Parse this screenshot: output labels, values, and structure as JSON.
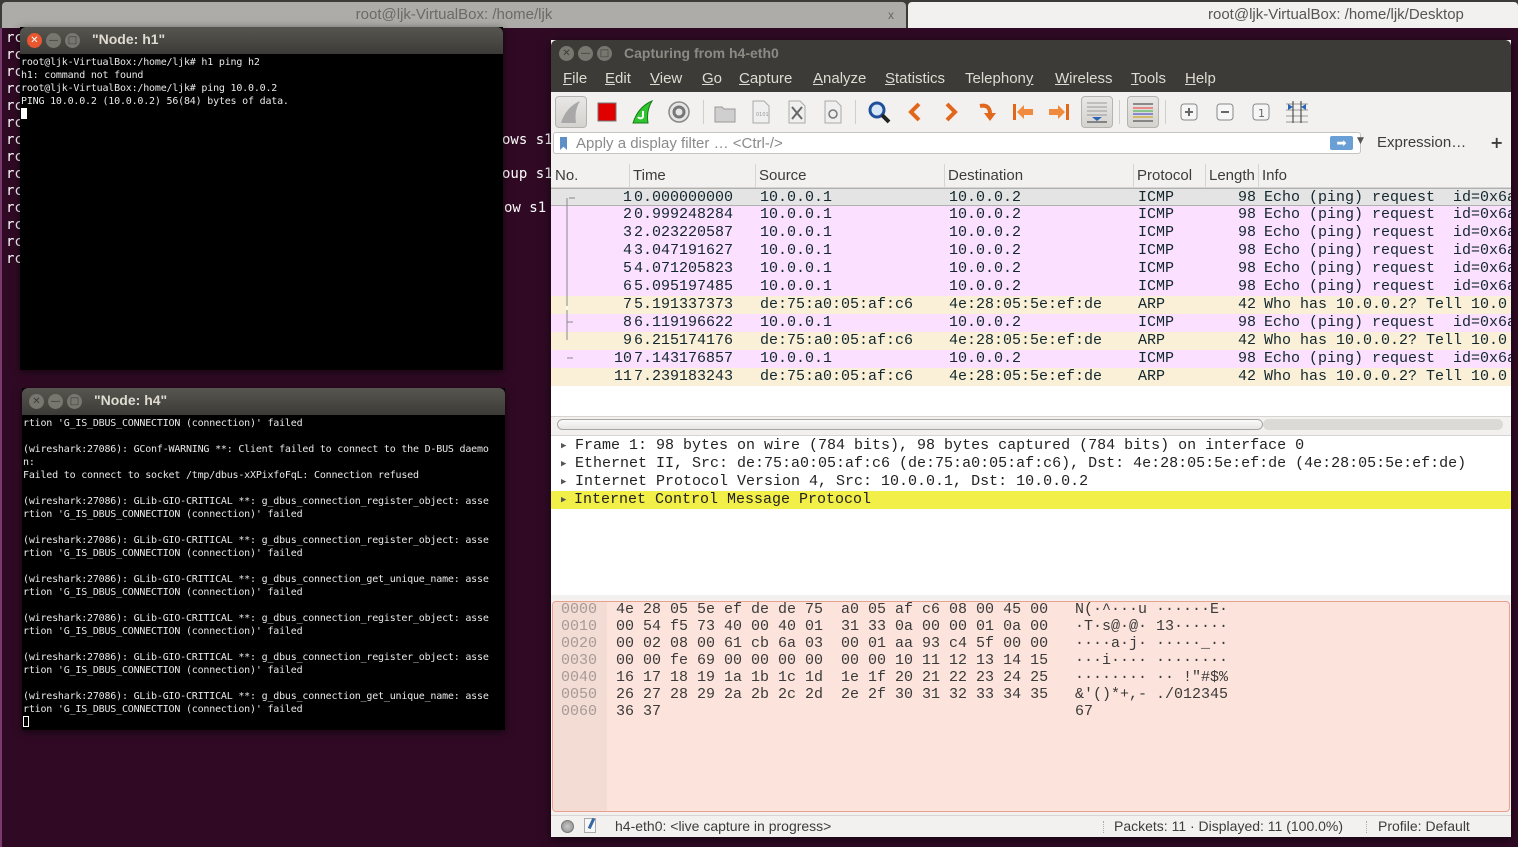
{
  "background_terminal": {
    "tabs": [
      {
        "title": "root@ljk-VirtualBox: /home/ljk",
        "close": "x"
      },
      {
        "title": "root@ljk-VirtualBox: /home/ljk/Desktop"
      }
    ],
    "line_prefix": "rc",
    "visible_fragments": [
      "ows s1",
      "oup s1",
      "ow s1"
    ]
  },
  "node_h1": {
    "title": "\"Node: h1\"",
    "lines": [
      "root@ljk-VirtualBox:/home/ljk# h1 ping h2",
      "h1: command not found",
      "root@ljk-VirtualBox:/home/ljk# ping 10.0.0.2",
      "PING 10.0.0.2 (10.0.0.2) 56(84) bytes of data."
    ]
  },
  "node_h4": {
    "title": "\"Node: h4\"",
    "lines": [
      "rtion 'G_IS_DBUS_CONNECTION (connection)' failed",
      "",
      "(wireshark:27086): GConf-WARNING **: Client failed to connect to the D-BUS daemo",
      "n:",
      "Failed to connect to socket /tmp/dbus-xXPixfoFqL: Connection refused",
      "",
      "(wireshark:27086): GLib-GIO-CRITICAL **: g_dbus_connection_register_object: asse",
      "rtion 'G_IS_DBUS_CONNECTION (connection)' failed",
      "",
      "(wireshark:27086): GLib-GIO-CRITICAL **: g_dbus_connection_register_object: asse",
      "rtion 'G_IS_DBUS_CONNECTION (connection)' failed",
      "",
      "(wireshark:27086): GLib-GIO-CRITICAL **: g_dbus_connection_get_unique_name: asse",
      "rtion 'G_IS_DBUS_CONNECTION (connection)' failed",
      "",
      "(wireshark:27086): GLib-GIO-CRITICAL **: g_dbus_connection_register_object: asse",
      "rtion 'G_IS_DBUS_CONNECTION (connection)' failed",
      "",
      "(wireshark:27086): GLib-GIO-CRITICAL **: g_dbus_connection_register_object: asse",
      "rtion 'G_IS_DBUS_CONNECTION (connection)' failed",
      "",
      "(wireshark:27086): GLib-GIO-CRITICAL **: g_dbus_connection_get_unique_name: asse",
      "rtion 'G_IS_DBUS_CONNECTION (connection)' failed"
    ]
  },
  "wireshark": {
    "title": "Capturing from h4-eth0",
    "menu": [
      {
        "label": "File",
        "mnemonic": "F"
      },
      {
        "label": "Edit",
        "mnemonic": "E"
      },
      {
        "label": "View",
        "mnemonic": "V"
      },
      {
        "label": "Go",
        "mnemonic": "G"
      },
      {
        "label": "Capture",
        "mnemonic": "C"
      },
      {
        "label": "Analyze",
        "mnemonic": "A"
      },
      {
        "label": "Statistics",
        "mnemonic": "S"
      },
      {
        "label": "Telephony",
        "mnemonic": "y"
      },
      {
        "label": "Wireless",
        "mnemonic": "W"
      },
      {
        "label": "Tools",
        "mnemonic": "T"
      },
      {
        "label": "Help",
        "mnemonic": "H"
      }
    ],
    "toolbar": [
      "start-capture-icon",
      "stop-capture-icon",
      "restart-capture-icon",
      "capture-options-icon",
      "open-file-icon",
      "save-file-icon",
      "close-file-icon",
      "reload-file-icon",
      "find-packet-icon",
      "go-back-icon",
      "go-forward-icon",
      "go-to-packet-icon",
      "first-packet-icon",
      "last-packet-icon",
      "auto-scroll-icon",
      "colorize-icon",
      "zoom-in-icon",
      "zoom-out-icon",
      "normal-size-icon",
      "resize-columns-icon"
    ],
    "filter": {
      "placeholder": "Apply a display filter … <Ctrl-/>",
      "value": "",
      "apply_icon": "arrow-right-icon",
      "expression_label": "Expression…",
      "add_label": "+"
    },
    "columns": [
      "No.",
      "Time",
      "Source",
      "Destination",
      "Protocol",
      "Length",
      "Info"
    ],
    "packets": [
      {
        "no": "1",
        "time": "0.000000000",
        "source": "10.0.0.1",
        "destination": "10.0.0.2",
        "protocol": "ICMP",
        "length": "98",
        "info": "Echo (ping) request  id=0x6a",
        "color": "#e4e4e4",
        "selected": true
      },
      {
        "no": "2",
        "time": "0.999248284",
        "source": "10.0.0.1",
        "destination": "10.0.0.2",
        "protocol": "ICMP",
        "length": "98",
        "info": "Echo (ping) request  id=0x6a",
        "color": "#fce0ff"
      },
      {
        "no": "3",
        "time": "2.023220587",
        "source": "10.0.0.1",
        "destination": "10.0.0.2",
        "protocol": "ICMP",
        "length": "98",
        "info": "Echo (ping) request  id=0x6a",
        "color": "#fce0ff"
      },
      {
        "no": "4",
        "time": "3.047191627",
        "source": "10.0.0.1",
        "destination": "10.0.0.2",
        "protocol": "ICMP",
        "length": "98",
        "info": "Echo (ping) request  id=0x6a",
        "color": "#fce0ff"
      },
      {
        "no": "5",
        "time": "4.071205823",
        "source": "10.0.0.1",
        "destination": "10.0.0.2",
        "protocol": "ICMP",
        "length": "98",
        "info": "Echo (ping) request  id=0x6a",
        "color": "#fce0ff"
      },
      {
        "no": "6",
        "time": "5.095197485",
        "source": "10.0.0.1",
        "destination": "10.0.0.2",
        "protocol": "ICMP",
        "length": "98",
        "info": "Echo (ping) request  id=0x6a",
        "color": "#fce0ff"
      },
      {
        "no": "7",
        "time": "5.191337373",
        "source": "de:75:a0:05:af:c6",
        "destination": "4e:28:05:5e:ef:de",
        "protocol": "ARP",
        "length": "42",
        "info": "Who has 10.0.0.2? Tell 10.0",
        "color": "#faf0d7"
      },
      {
        "no": "8",
        "time": "6.119196622",
        "source": "10.0.0.1",
        "destination": "10.0.0.2",
        "protocol": "ICMP",
        "length": "98",
        "info": "Echo (ping) request  id=0x6a",
        "color": "#fce0ff"
      },
      {
        "no": "9",
        "time": "6.215174176",
        "source": "de:75:a0:05:af:c6",
        "destination": "4e:28:05:5e:ef:de",
        "protocol": "ARP",
        "length": "42",
        "info": "Who has 10.0.0.2? Tell 10.0",
        "color": "#faf0d7"
      },
      {
        "no": "10",
        "time": "7.143176857",
        "source": "10.0.0.1",
        "destination": "10.0.0.2",
        "protocol": "ICMP",
        "length": "98",
        "info": "Echo (ping) request  id=0x6a",
        "color": "#fce0ff"
      },
      {
        "no": "11",
        "time": "7.239183243",
        "source": "de:75:a0:05:af:c6",
        "destination": "4e:28:05:5e:ef:de",
        "protocol": "ARP",
        "length": "42",
        "info": "Who has 10.0.0.2? Tell 10.0",
        "color": "#faf0d7"
      }
    ],
    "details": [
      {
        "text": "Frame 1: 98 bytes on wire (784 bits), 98 bytes captured (784 bits) on interface 0",
        "highlighted": false
      },
      {
        "text": "Ethernet II, Src: de:75:a0:05:af:c6 (de:75:a0:05:af:c6), Dst: 4e:28:05:5e:ef:de (4e:28:05:5e:ef:de)",
        "highlighted": false
      },
      {
        "text": "Internet Protocol Version 4, Src: 10.0.0.1, Dst: 10.0.0.2",
        "highlighted": false
      },
      {
        "text": "Internet Control Message Protocol",
        "highlighted": true
      }
    ],
    "bytes": [
      {
        "offset": "0000",
        "hex": "4e 28 05 5e ef de de 75  a0 05 af c6 08 00 45 00",
        "ascii": "N(·^···u ······E·"
      },
      {
        "offset": "0010",
        "hex": "00 54 f5 73 40 00 40 01  31 33 0a 00 00 01 0a 00",
        "ascii": "·T·s@·@· 13······"
      },
      {
        "offset": "0020",
        "hex": "00 02 08 00 61 cb 6a 03  00 01 aa 93 c4 5f 00 00",
        "ascii": "····a·j· ·····_··"
      },
      {
        "offset": "0030",
        "hex": "00 00 fe 69 00 00 00 00  00 00 10 11 12 13 14 15",
        "ascii": "···i···· ········"
      },
      {
        "offset": "0040",
        "hex": "16 17 18 19 1a 1b 1c 1d  1e 1f 20 21 22 23 24 25",
        "ascii": "········ ·· !\"#$%"
      },
      {
        "offset": "0050",
        "hex": "26 27 28 29 2a 2b 2c 2d  2e 2f 30 31 32 33 34 35",
        "ascii": "&'()*+,- ./012345"
      },
      {
        "offset": "0060",
        "hex": "36 37",
        "ascii": "67"
      }
    ],
    "status": {
      "interface": "h4-eth0: <live capture in progress>",
      "packets": "Packets: 11 · Displayed: 11 (100.0%)",
      "profile": "Profile: Default"
    }
  }
}
